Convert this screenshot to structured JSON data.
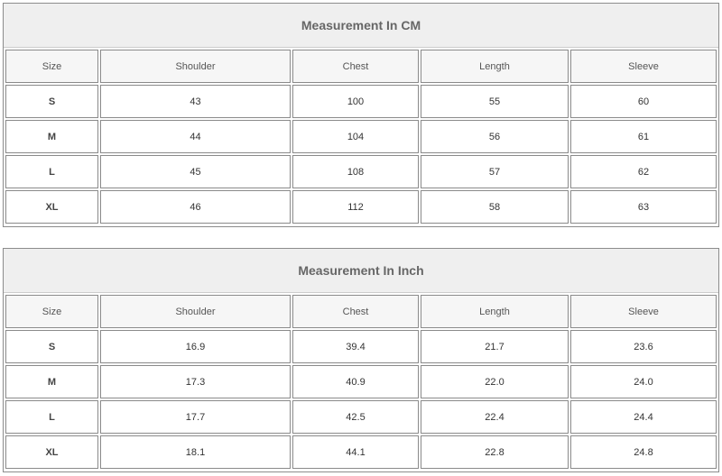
{
  "columns": [
    "Size",
    "Shoulder",
    "Chest",
    "Length",
    "Sleeve"
  ],
  "cm": {
    "title": "Measurement In CM",
    "rows": [
      [
        "S",
        "43",
        "100",
        "55",
        "60"
      ],
      [
        "M",
        "44",
        "104",
        "56",
        "61"
      ],
      [
        "L",
        "45",
        "108",
        "57",
        "62"
      ],
      [
        "XL",
        "46",
        "112",
        "58",
        "63"
      ]
    ]
  },
  "inch": {
    "title": "Measurement In Inch",
    "rows": [
      [
        "S",
        "16.9",
        "39.4",
        "21.7",
        "23.6"
      ],
      [
        "M",
        "17.3",
        "40.9",
        "22.0",
        "24.0"
      ],
      [
        "L",
        "17.7",
        "42.5",
        "22.4",
        "24.4"
      ],
      [
        "XL",
        "18.1",
        "44.1",
        "22.8",
        "24.8"
      ]
    ]
  }
}
